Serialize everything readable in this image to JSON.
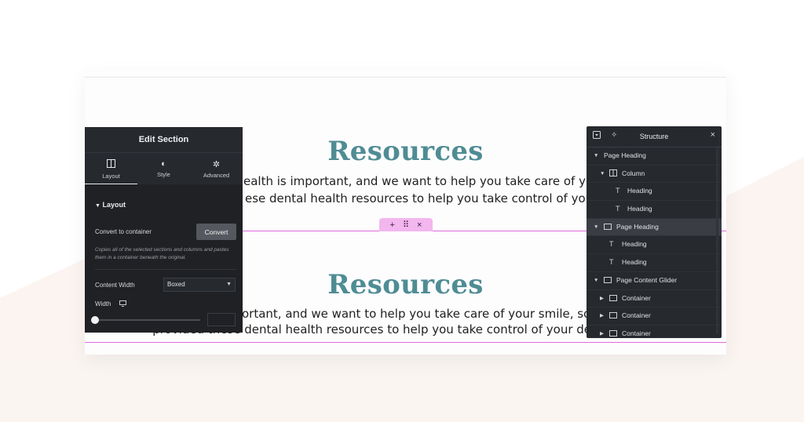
{
  "canvas": {
    "section1": {
      "title": "Resources",
      "line1": "ealth is important, and we want to help you take care of your smile",
      "line2": "ese dental health resources to help you take control of your denta"
    },
    "section2": {
      "title": "Resources",
      "line1": "ortant, and we want to help you take care of your smile, so we've",
      "line2": "provided these dental health resources to help you take control of your dental health."
    },
    "handle": {
      "add": "+",
      "drag": "⠿",
      "close": "×"
    }
  },
  "edit_panel": {
    "title": "Edit Section",
    "tabs": [
      {
        "label": "Layout",
        "icon": "columns-icon"
      },
      {
        "label": "Style",
        "icon": "half-circle-icon"
      },
      {
        "label": "Advanced",
        "icon": "gear-icon"
      }
    ],
    "layout_heading": "Layout",
    "convert_label": "Convert to container",
    "convert_button": "Convert",
    "convert_help": "Copies all of the selected sections and columns and pastes them in a container beneath the original.",
    "content_width_label": "Content Width",
    "content_width_value": "Boxed",
    "width_label": "Width",
    "width_value": ""
  },
  "structure_panel": {
    "title": "Structure",
    "items": [
      {
        "label": "Page Heading",
        "depth": 0,
        "expanded": true,
        "icon": "none"
      },
      {
        "label": "Column",
        "depth": 1,
        "expanded": true,
        "icon": "column-icon"
      },
      {
        "label": "Heading",
        "depth": 2,
        "expanded": null,
        "icon": "text-icon"
      },
      {
        "label": "Heading",
        "depth": 2,
        "expanded": null,
        "icon": "text-icon"
      },
      {
        "label": "Page Heading",
        "depth": 0,
        "expanded": true,
        "icon": "container-icon",
        "selected": true
      },
      {
        "label": "Heading",
        "depth": 1,
        "expanded": null,
        "icon": "text-icon"
      },
      {
        "label": "Heading",
        "depth": 1,
        "expanded": null,
        "icon": "text-icon"
      },
      {
        "label": "Page Content Glider",
        "depth": 0,
        "expanded": true,
        "icon": "container-icon"
      },
      {
        "label": "Container",
        "depth": 1,
        "expanded": false,
        "icon": "container-icon"
      },
      {
        "label": "Container",
        "depth": 1,
        "expanded": false,
        "icon": "container-icon"
      },
      {
        "label": "Container",
        "depth": 1,
        "expanded": false,
        "icon": "container-icon"
      }
    ]
  },
  "colors": {
    "title_teal": "#4f8c94",
    "panel_dark": "#26292e",
    "selection_pink": "#e26bdc"
  }
}
